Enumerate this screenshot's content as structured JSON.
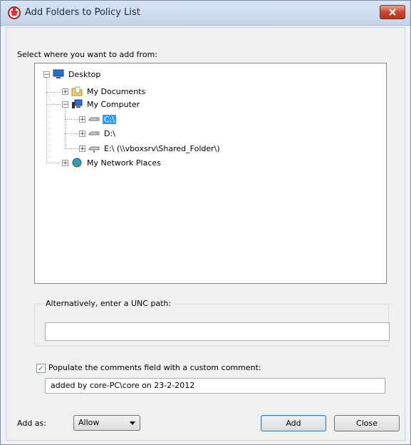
{
  "window": {
    "title": "Add Folders to Policy List"
  },
  "select_label": "Select where you want to add from:",
  "tree": {
    "desktop": "Desktop",
    "my_documents": "My Documents",
    "my_computer": "My Computer",
    "drive_c": "C:\\",
    "drive_d": "D:\\",
    "drive_e": "E:\\  (\\\\vboxsrv\\Shared_Folder\\)",
    "network": "My Network Places"
  },
  "unc": {
    "label": "Alternatively, enter a UNC path:",
    "value": ""
  },
  "comment": {
    "checkbox_label": "Populate the comments field with a custom comment:",
    "checked": true,
    "value": "added by core-PC\\core on 23-2-2012"
  },
  "add_as": {
    "label": "Add as:",
    "selected": "Allow"
  },
  "buttons": {
    "add": "Add",
    "close": "Close"
  }
}
